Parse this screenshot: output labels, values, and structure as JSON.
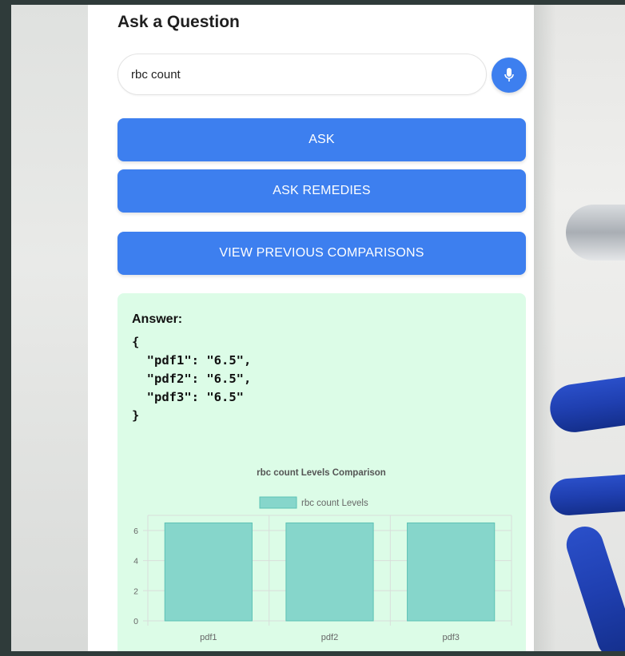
{
  "panel": {
    "title": "Ask a Question"
  },
  "search": {
    "value": "rbc count",
    "mic_icon": "microphone-icon"
  },
  "buttons": {
    "ask": "ASK",
    "ask_remedies": "ASK REMEDIES",
    "view_previous": "VIEW PREVIOUS COMPARISONS"
  },
  "answer": {
    "label": "Answer:",
    "json_text": "{\n  \"pdf1\": \"6.5\",\n  \"pdf2\": \"6.5\",\n  \"pdf3\": \"6.5\"\n}"
  },
  "colors": {
    "accent": "#3d7fef",
    "answer_bg": "#dcfce7",
    "bar_fill": "#86d6cb",
    "bar_stroke": "#5cc2b4"
  },
  "chart_data": {
    "type": "bar",
    "title": "rbc count Levels Comparison",
    "categories": [
      "pdf1",
      "pdf2",
      "pdf3"
    ],
    "series": [
      {
        "name": "rbc count Levels",
        "values": [
          6.5,
          6.5,
          6.5
        ]
      }
    ],
    "yticks": [
      0,
      2,
      4,
      6
    ],
    "ylim": [
      0,
      7
    ],
    "grid": true,
    "legend": "top"
  }
}
